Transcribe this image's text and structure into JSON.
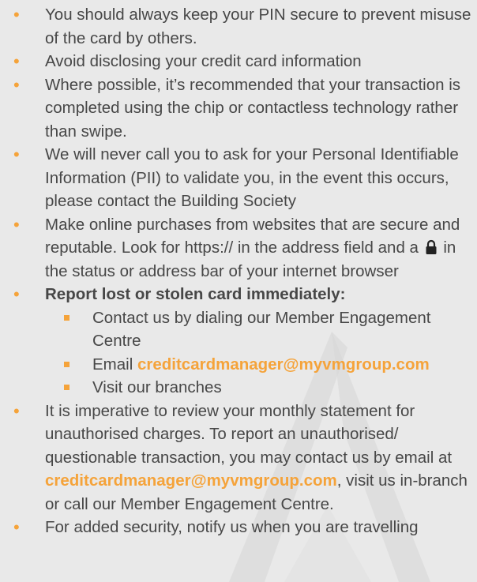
{
  "colors": {
    "accent": "#f5a33a",
    "text": "#474747",
    "background": "#e9e9e9",
    "watermark": "#dddddd"
  },
  "items": [
    {
      "text": "You should always keep your PIN secure to prevent misuse of the card by others."
    },
    {
      "text": "Avoid disclosing your credit card information"
    },
    {
      "text": "Where possible, it’s recommended that your transaction is completed using the chip or contactless technology rather than swipe."
    },
    {
      "text": "We will never call you to ask for your Personal Identifiable Information (PII) to validate you, in the event this occurs, please contact the Building Society"
    },
    {
      "text_before_icon": "Make online purchases from websites that are secure and reputable. Look for https:// in the address field and a",
      "icon": "lock-icon",
      "text_after_icon": "in the status or address bar of your internet browser"
    },
    {
      "heading": "Report lost or stolen card immediately:",
      "subitems": [
        {
          "text": "Contact us by dialing our Member Engagement Centre"
        },
        {
          "prefix": "Email",
          "link": "creditcardmanager@myvmgroup.com"
        },
        {
          "text": "Visit our branches"
        }
      ]
    },
    {
      "text_before_link": "It is imperative to review your monthly statement for unauthorised charges. To report an unauthorised/ questionable transaction, you may contact us by email at",
      "link": "creditcardmanager@myvmgroup.com",
      "text_after_link": ", visit us in-branch or call our Member Engagement Centre."
    },
    {
      "text": "For added security, notify us when you are travelling"
    }
  ]
}
